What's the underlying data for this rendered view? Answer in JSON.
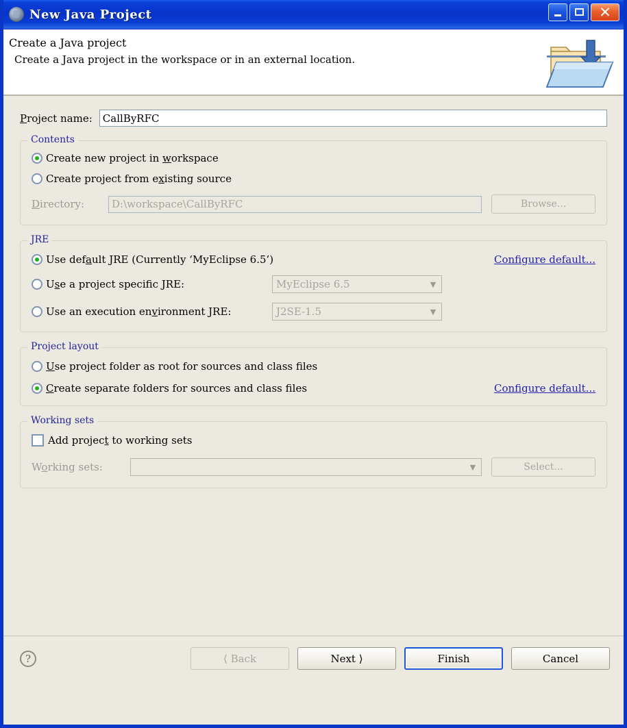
{
  "window": {
    "title": "New Java Project",
    "icon": "java-project-icon",
    "buttons": {
      "minimize": "minimize-button",
      "maximize": "maximize-button",
      "close": "close-button"
    }
  },
  "banner": {
    "title": "Create a Java project",
    "subtitle": "Create a Java project in the workspace or in an external location.",
    "icon": "new-java-project-folder-icon"
  },
  "project_name": {
    "label": "Project name:",
    "label_mnemonic": "P",
    "value": "CallByRFC"
  },
  "contents": {
    "legend": "Contents",
    "options": [
      {
        "label": "Create new project in workspace",
        "mnemonic": "w",
        "checked": true
      },
      {
        "label": "Create project from existing source",
        "mnemonic": "x",
        "checked": false
      }
    ],
    "directory": {
      "label": "Directory:",
      "label_mnemonic": "D",
      "value": "D:\\workspace\\CallByRFC",
      "disabled": true,
      "browse_label": "Browse...",
      "browse_mnemonic": "r"
    }
  },
  "jre": {
    "legend": "JRE",
    "options": [
      {
        "label": "Use default JRE (Currently 'MyEclipse 6.5')",
        "mnemonic": "a",
        "checked": true,
        "link": "Configure default..."
      },
      {
        "label": "Use a project specific JRE:",
        "mnemonic": "s",
        "checked": false,
        "combo_value": "MyEclipse 6.5",
        "combo_disabled": true
      },
      {
        "label": "Use an execution environment JRE:",
        "mnemonic": "v",
        "checked": false,
        "combo_value": "J2SE-1.5",
        "combo_disabled": true
      }
    ]
  },
  "project_layout": {
    "legend": "Project layout",
    "options": [
      {
        "label": "Use project folder as root for sources and class files",
        "mnemonic": "U",
        "checked": false
      },
      {
        "label": "Create separate folders for sources and class files",
        "mnemonic": "C",
        "checked": true,
        "link": "Configure default..."
      }
    ]
  },
  "working_sets": {
    "legend": "Working sets",
    "checkbox": {
      "label": "Add project to working sets",
      "mnemonic": "t",
      "checked": false
    },
    "combo_label": "Working sets:",
    "combo_label_mnemonic": "o",
    "combo_value": "",
    "combo_disabled": true,
    "select_label": "Select...",
    "select_mnemonic": "e"
  },
  "footer": {
    "help": "?",
    "back": "< Back",
    "back_mnemonic": "B",
    "back_disabled": true,
    "next": "Next >",
    "next_mnemonic": "N",
    "finish": "Finish",
    "finish_mnemonic": "F",
    "finish_default": true,
    "cancel": "Cancel"
  },
  "colors": {
    "title_bar": "#0b41d8",
    "dialog_bg": "#ece9e0",
    "legend_text": "#24249b",
    "link": "#2222aa",
    "radio_dot": "#22b120",
    "disabled_text": "#a7a49c",
    "close_button": "#e85f2a"
  }
}
